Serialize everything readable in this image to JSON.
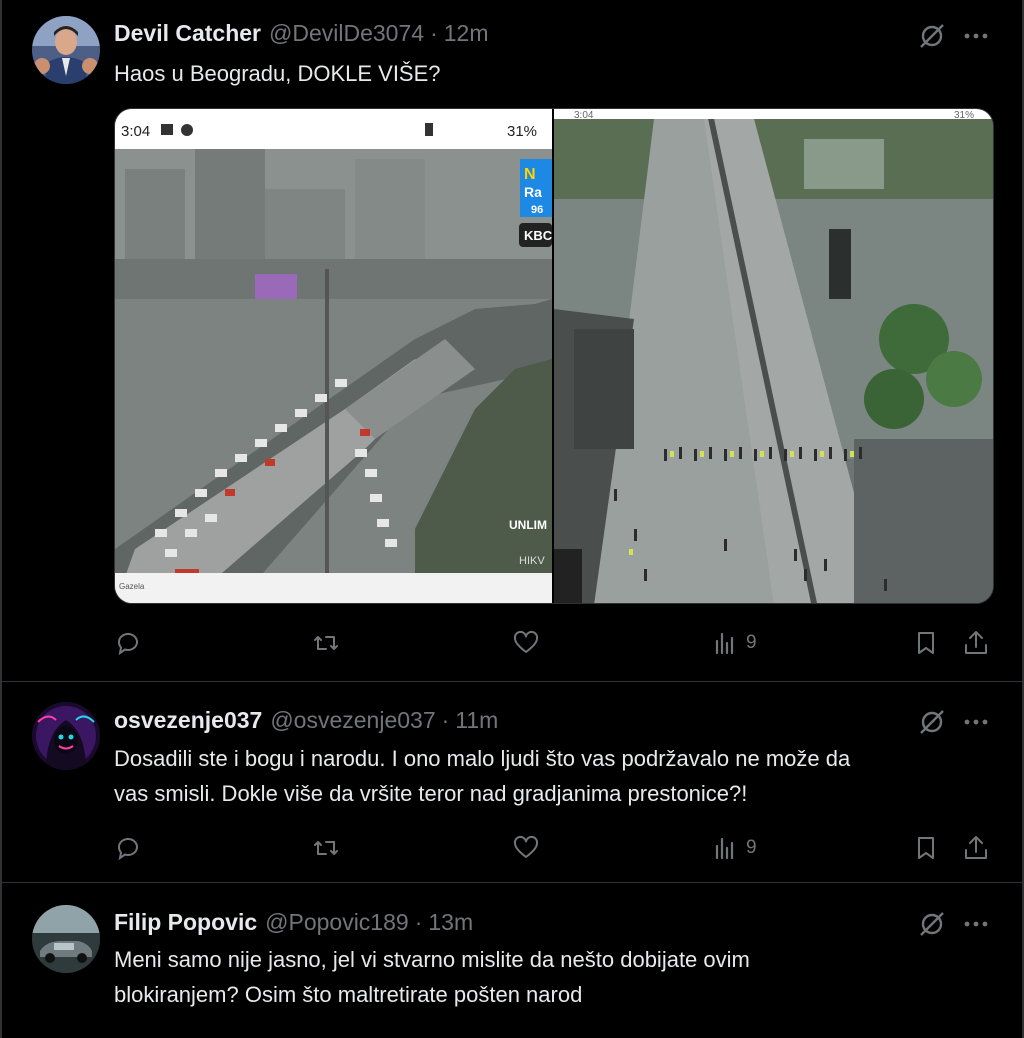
{
  "tweets": [
    {
      "name": "Devil Catcher",
      "handle": "@DevilDe3074",
      "separator": "·",
      "time": "12m",
      "text": "Haos u Beogradu, DOKLE VIŠE?",
      "views": "9",
      "media": {
        "left_status_time": "3:04",
        "left_status_battery": "31%",
        "left_logo_top": "N",
        "left_logo_mid": "Ra",
        "left_logo_bottom": "96",
        "left_badge": "KBC",
        "left_watermark": "UNLIM",
        "left_watermark2": "HIKV",
        "left_caption": "Gazela",
        "right_status_time": "3:04",
        "right_status_battery": "31%"
      }
    },
    {
      "name": "osvezenje037",
      "handle": "@osvezenje037",
      "separator": "·",
      "time": "11m",
      "text_line1": "Dosadili ste i bogu i narodu. I ono malo ljudi što vas podržavalo ne može da",
      "text_line2": "vas smisli. Dokle više da vršite teror nad gradjanima prestonice?!",
      "views": "9"
    },
    {
      "name": "Filip Popovic",
      "handle": "@Popovic189",
      "separator": "·",
      "time": "13m",
      "text_line1": "Meni samo nije jasno, jel vi stvarno mislite da nešto dobijate ovim",
      "text_line2": "blokiranjem? Osim što maltretirate pošten narod"
    }
  ],
  "icons": {
    "grok": "grok-icon",
    "more": "more-icon",
    "reply": "reply-icon",
    "retweet": "retweet-icon",
    "like": "like-icon",
    "views": "views-icon",
    "bookmark": "bookmark-icon",
    "share": "share-icon"
  },
  "colors": {
    "background": "#000000",
    "text": "#e7e9ea",
    "secondary": "#71767b",
    "border": "#2f3336"
  }
}
